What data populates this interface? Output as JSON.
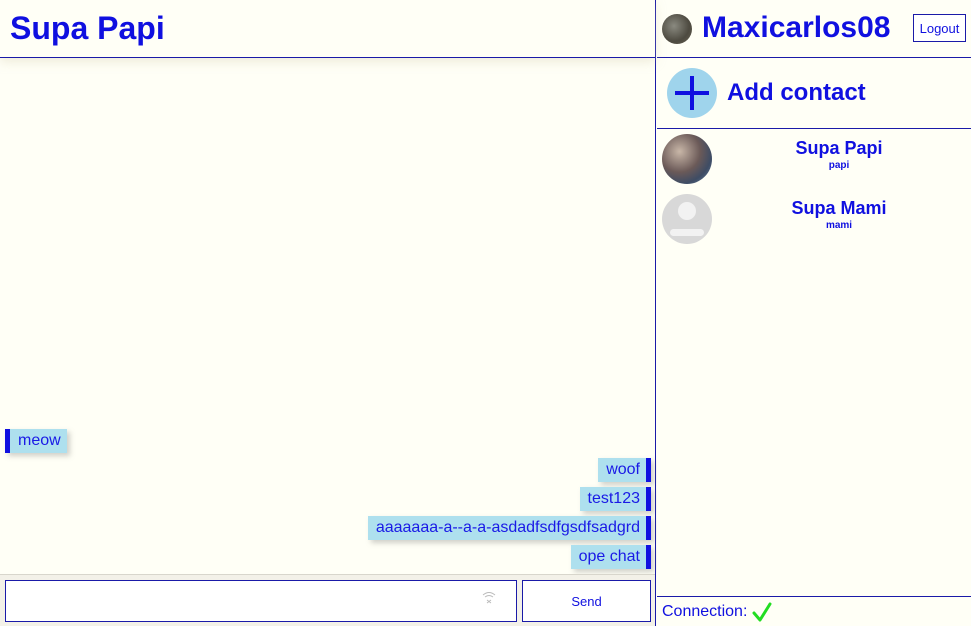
{
  "chat": {
    "title": "Supa Papi",
    "messages": [
      {
        "text": "meow",
        "direction": "in"
      },
      {
        "text": "woof",
        "direction": "out"
      },
      {
        "text": "test123",
        "direction": "out"
      },
      {
        "text": "aaaaaaa-a--a-a-asdadfsdfgsdfsadgrd",
        "direction": "out"
      },
      {
        "text": "ope chat",
        "direction": "out"
      }
    ],
    "input_value": "",
    "send_label": "Send"
  },
  "user": {
    "name": "Maxicarlos08",
    "logout_label": "Logout"
  },
  "sidebar": {
    "add_contact_label": "Add contact",
    "contacts": [
      {
        "name": "Supa Papi",
        "username": "papi",
        "avatar": "photo"
      },
      {
        "name": "Supa Mami",
        "username": "mami",
        "avatar": "default"
      }
    ]
  },
  "status": {
    "connection_label": "Connection:",
    "connection_state": "connected",
    "check_color": "#22dd22"
  },
  "colors": {
    "accent": "#1010e0",
    "bubble": "#aee0ee",
    "background": "#fffff6"
  }
}
